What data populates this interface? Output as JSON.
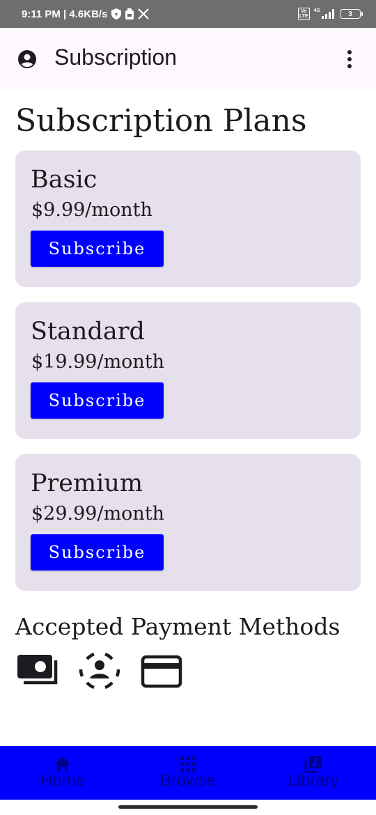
{
  "status_bar": {
    "time_speed": "9:11 PM | 4.6KB/s",
    "volte": "Vo\nLTE",
    "network": "4G",
    "battery": "3"
  },
  "app_bar": {
    "title": "Subscription",
    "icons": [
      "account-circle-icon",
      "more-vert-icon"
    ]
  },
  "main": {
    "heading": "Subscription Plans",
    "plans": [
      {
        "name": "Basic",
        "price": "$9.99/month",
        "button": "Subscribe"
      },
      {
        "name": "Standard",
        "price": "$19.99/month",
        "button": "Subscribe"
      },
      {
        "name": "Premium",
        "price": "$29.99/month",
        "button": "Subscribe"
      }
    ],
    "payment_heading": "Accepted Payment Methods",
    "payment_icons": [
      "cash-icon",
      "account-dashed-icon",
      "credit-card-icon"
    ]
  },
  "bottom_nav": {
    "items": [
      {
        "label": "Home",
        "icon": "home-icon"
      },
      {
        "label": "Browse",
        "icon": "apps-grid-icon"
      },
      {
        "label": "Library",
        "icon": "library-music-icon"
      }
    ]
  },
  "colors": {
    "accent": "#0000ff",
    "card_bg": "#e6e0ec",
    "app_bar_bg": "#fdf7ff",
    "status_bar_bg": "#6e6e6e",
    "nav_label": "#000090"
  }
}
